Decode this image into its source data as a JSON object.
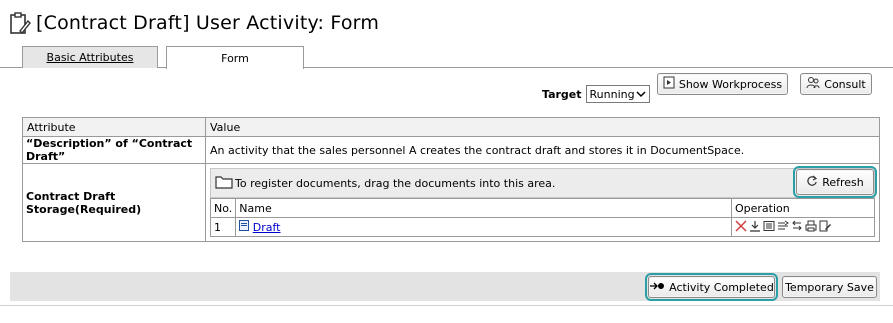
{
  "title": "[Contract Draft] User Activity: Form",
  "tabs": [
    {
      "label": "Basic Attributes"
    },
    {
      "label": "Form"
    }
  ],
  "target": {
    "label": "Target",
    "selected": "Running"
  },
  "buttons": {
    "show_workprocess": "Show Workprocess",
    "consult": "Consult",
    "refresh": "Refresh",
    "activity_completed": "Activity Completed",
    "temporary_save": "Temporary Save"
  },
  "attributes_table": {
    "headers": [
      "Attribute",
      "Value"
    ],
    "rows": [
      {
        "attribute": "“Description” of “Contract Draft”",
        "value": "An activity that the sales personnel A creates the contract draft and stores it in DocumentSpace."
      },
      {
        "attribute": "Contract Draft Storage(Required)"
      }
    ]
  },
  "document_area": {
    "drop_hint": "To register documents, drag the documents into this area.",
    "headers": [
      "No.",
      "Name",
      "Operation"
    ],
    "rows": [
      {
        "no": "1",
        "name": "Draft"
      }
    ]
  },
  "colors": {
    "highlight": "#2a9fa5",
    "delete_icon": "#d43c3c",
    "link": "#0000cc"
  }
}
